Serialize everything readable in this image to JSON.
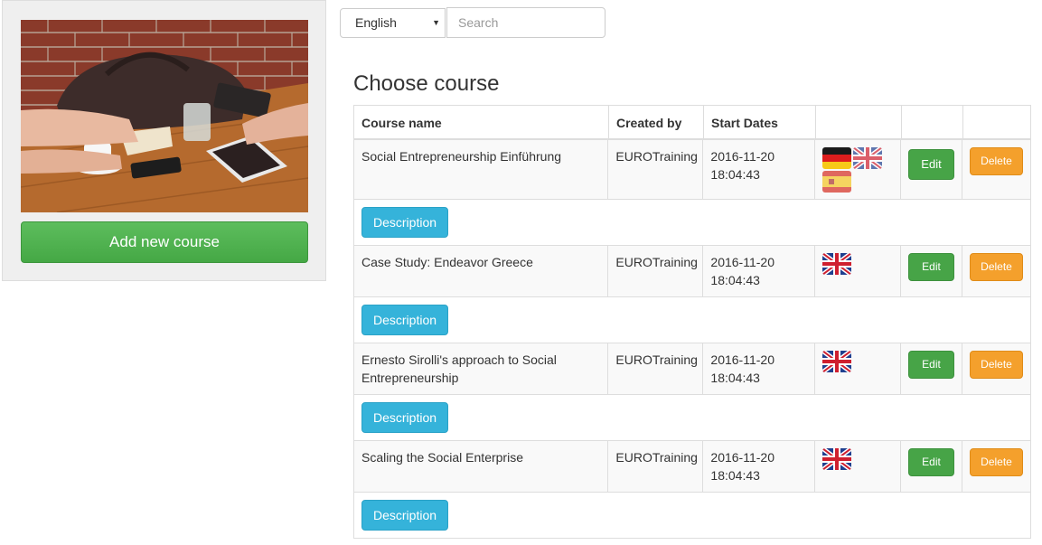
{
  "left_panel": {
    "photo_alt": "",
    "add_button_label": "Add new course"
  },
  "toolbar": {
    "language": "English",
    "search_placeholder": "Search"
  },
  "page_title": "Choose course",
  "table": {
    "headers": [
      "Course name",
      "Created by",
      "Start Dates",
      "",
      "",
      ""
    ],
    "rows": [
      {
        "name": "Social Entrepreneurship Einführung",
        "created_by": "EUROTraining",
        "start_date": "2016-11-20",
        "start_time": "18:04:43",
        "flags": [
          "flag-de-icon",
          "flag-uk-icon",
          "flag-es-icon"
        ],
        "edit_label": "Edit",
        "delete_label": "Delete",
        "description_label": "Description"
      },
      {
        "name": "Case Study: Endeavor Greece",
        "created_by": "EUROTraining",
        "start_date": "2016-11-20",
        "start_time": "18:04:43",
        "flags": [
          "flag-uk-icon"
        ],
        "edit_label": "Edit",
        "delete_label": "Delete",
        "description_label": "Description"
      },
      {
        "name": "Ernesto Sirolli's approach to Social Entrepreneurship",
        "created_by": "EUROTraining",
        "start_date": "2016-11-20",
        "start_time": "18:04:43",
        "flags": [
          "flag-uk-icon"
        ],
        "edit_label": "Edit",
        "delete_label": "Delete",
        "description_label": "Description"
      },
      {
        "name": "Scaling the Social Enterprise",
        "created_by": "EUROTraining",
        "start_date": "2016-11-20",
        "start_time": "18:04:43",
        "flags": [
          "flag-uk-icon"
        ],
        "edit_label": "Edit",
        "delete_label": "Delete",
        "description_label": "Description"
      }
    ]
  },
  "colors": {
    "success": "#47a447",
    "warning": "#f4a02c",
    "info": "#35b3da"
  }
}
